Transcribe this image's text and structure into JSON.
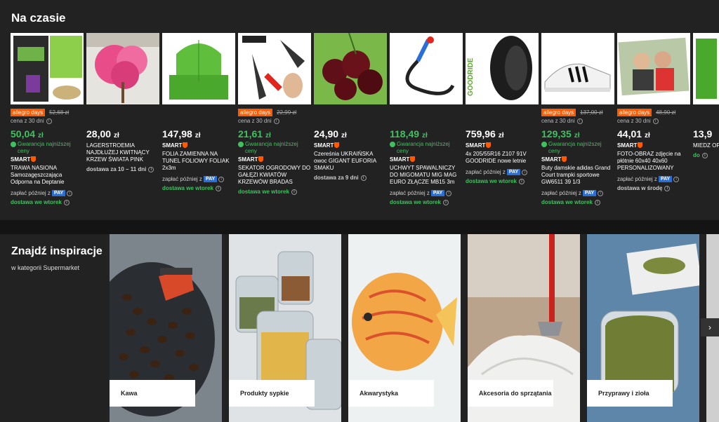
{
  "section": {
    "title": "Na czasie"
  },
  "labels": {
    "allegro_days": "allegro days",
    "cena30": "cena z 30 dni",
    "gwarancja": "Gwarancja najniższej ceny",
    "smart": "SMART",
    "zaplac": "zapłać później z",
    "pay": "PAY"
  },
  "products": [
    {
      "badge": true,
      "old": "52,68 zł",
      "price_main": "50,04",
      "price_cur": "zł",
      "green": true,
      "gw": true,
      "smart": true,
      "name": "TRAWA NASIONA Samozagęszczająca Odporna na Deptanie",
      "pay": true,
      "delivery": "dostawa we wtorek",
      "dgreen": true
    },
    {
      "badge": false,
      "old": "",
      "price_main": "28,00",
      "price_cur": "zł",
      "green": false,
      "gw": false,
      "smart": false,
      "name": "LAGERSTROEMIA NAJDŁUŻEJ KWITNĄCY KRZEW ŚWIATA PINK",
      "pay": false,
      "delivery": "dostawa za 10 – 11 dni",
      "dgreen": false
    },
    {
      "badge": false,
      "old": "",
      "price_main": "147,98",
      "price_cur": "zł",
      "green": false,
      "gw": false,
      "smart": true,
      "name": "FOLIA ZAMIENNA NA TUNEL FOLIOWY FOLIAK 2x3m",
      "pay": true,
      "delivery": "dostawa we wtorek",
      "dgreen": true
    },
    {
      "badge": true,
      "old": "22,99 zł",
      "price_main": "21,61",
      "price_cur": "zł",
      "green": true,
      "gw": true,
      "smart": true,
      "name": "SEKATOR OGRODOWY DO GAŁĘZI KWIATÓW KRZEWÓW BRADAS",
      "pay": false,
      "delivery": "dostawa we wtorek",
      "dgreen": true
    },
    {
      "badge": false,
      "old": "",
      "price_main": "24,90",
      "price_cur": "zł",
      "green": false,
      "gw": false,
      "smart": true,
      "name": "Czereśnia UKRAIŃSKA owoc GIGANT EUFORIA SMAKU",
      "pay": false,
      "delivery": "dostawa za 9 dni",
      "dgreen": false
    },
    {
      "badge": false,
      "old": "",
      "price_main": "118,49",
      "price_cur": "zł",
      "green": true,
      "gw": true,
      "smart": true,
      "name": "UCHWYT SPAWALNICZY DO MIGOMATU MIG MAG EURO ZŁĄCZE MB15 3m",
      "pay": true,
      "delivery": "dostawa we wtorek",
      "dgreen": true
    },
    {
      "badge": false,
      "old": "",
      "price_main": "759,96",
      "price_cur": "zł",
      "green": false,
      "gw": false,
      "smart": true,
      "name": "4x 205/55R16 Z107 91V GOODRIDE nowe letnie",
      "pay": true,
      "delivery": "dostawa we wtorek",
      "dgreen": true
    },
    {
      "badge": true,
      "old": "137,00 zł",
      "price_main": "129,35",
      "price_cur": "zł",
      "green": true,
      "gw": true,
      "smart": true,
      "name": "Buty damskie adidas Grand Court trampki sportowe GW6511 39 1/3",
      "pay": true,
      "delivery": "dostawa we wtorek",
      "dgreen": true
    },
    {
      "badge": true,
      "old": "48,90 zł",
      "price_main": "44,01",
      "price_cur": "zł",
      "green": false,
      "gw": false,
      "smart": true,
      "name": "FOTO-OBRAZ zdjęcie na płótnie 60x40 40x60 PERSONALIZOWANY",
      "pay": true,
      "delivery": "dostawa w środę",
      "dgreen": false
    },
    {
      "badge": false,
      "old": "",
      "price_main": "13,9",
      "price_cur": "",
      "green": false,
      "gw": false,
      "smart": false,
      "name": "MIEDZ OPRYS GRZYB",
      "pay": false,
      "delivery": "do",
      "dgreen": true
    }
  ],
  "inspiration": {
    "title": "Znajdź inspiracje",
    "subtitle": "w kategorii Supermarket",
    "tiles": [
      {
        "label": "Kawa"
      },
      {
        "label": "Produkty sypkie"
      },
      {
        "label": "Akwarystyka"
      },
      {
        "label": "Akcesoria do sprzątania"
      },
      {
        "label": "Przyprawy i zioła"
      }
    ],
    "next": "›"
  }
}
